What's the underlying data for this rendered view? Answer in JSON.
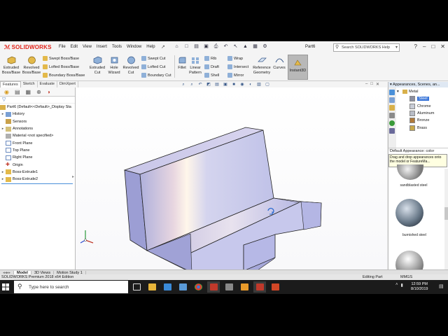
{
  "app": {
    "brand": "SOLIDWORKS",
    "doc_title": "Part6",
    "menus": [
      "File",
      "Edit",
      "View",
      "Insert",
      "Tools",
      "Window",
      "Help"
    ],
    "search_placeholder": "Search SOLIDWORKS Help"
  },
  "commands": {
    "extruded_boss": "Extruded Boss/Base",
    "revolved_boss": "Revolved Boss/Base",
    "swept_boss": "Swept Boss/Base",
    "lofted_boss": "Lofted Boss/Base",
    "boundary_boss": "Boundary Boss/Base",
    "extruded_cut": "Extruded Cut",
    "hole_wizard": "Hole Wizard",
    "revolved_cut": "Revolved Cut",
    "swept_cut": "Swept Cut",
    "lofted_cut": "Lofted Cut",
    "boundary_cut": "Boundary Cut",
    "fillet": "Fillet",
    "linear_pattern": "Linear Pattern",
    "rib": "Rib",
    "draft": "Draft",
    "shell": "Shell",
    "wrap": "Wrap",
    "intersect": "Intersect",
    "mirror": "Mirror",
    "reference_geometry": "Reference Geometry",
    "curves": "Curves",
    "instant3d": "Instant3D"
  },
  "tabs": [
    "Features",
    "Sketch",
    "Evaluate",
    "DimXpert"
  ],
  "tree": {
    "root": "Part6 (Default<<Default>_Display Sta",
    "items": [
      "History",
      "Sensors",
      "Annotations",
      "Material <not specified>",
      "Front Plane",
      "Top Plane",
      "Right Plane",
      "Origin",
      "Boss-Extrude1",
      "Boss-Extrude2"
    ]
  },
  "taskpane": {
    "title": "Appearances, Scenes, an...",
    "folder": "Metal",
    "materials": [
      "Steel",
      "Chrome",
      "Aluminum",
      "Bronze",
      "Brass"
    ],
    "selected": "Steel",
    "info": "Default Appearance: color",
    "tooltip": "Drag and drop appearances onto the model or FeatureMa...",
    "gallery": [
      "sandblasted steel",
      "burnished steel"
    ]
  },
  "bottom_tabs": [
    "Model",
    "3D Views",
    "Motion Study 1"
  ],
  "status": {
    "left": "SOLIDWORKS Premium 2018 x64 Edition",
    "mode": "Editing Part",
    "units": "MMGS"
  },
  "taskbar": {
    "search": "Type here to search",
    "time": "12:59 PM",
    "date": "8/10/2019"
  },
  "colors": {
    "brand_red": "#e2231a",
    "selection_blue": "#3874d8",
    "model_face": "#b8b8e6",
    "taskbar": "#1b1b1b"
  }
}
